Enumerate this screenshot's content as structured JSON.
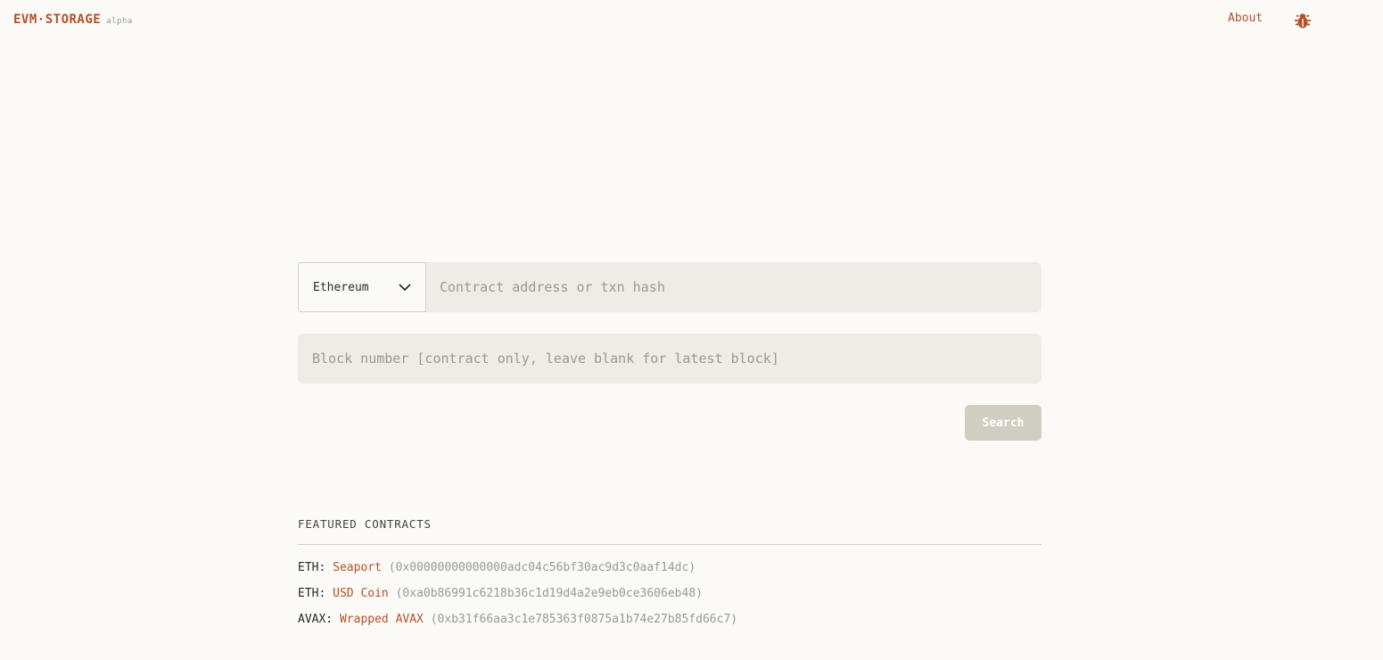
{
  "header": {
    "logo": "EVM·STORAGE",
    "badge": "alpha",
    "about": "About",
    "bug_icon": "bug-icon"
  },
  "colors": {
    "accent": "#b5502a",
    "background": "#fbfaf7",
    "input_bg": "#edece6",
    "button_bg": "#cfcec0"
  },
  "search": {
    "network": "Ethereum",
    "address_placeholder": "Contract address or txn hash",
    "block_placeholder": "Block number [contract only, leave blank for latest block]",
    "button": "Search"
  },
  "featured": {
    "title": "FEATURED CONTRACTS",
    "items": [
      {
        "chain": "ETH:",
        "name": "Seaport",
        "address": "(0x00000000000000adc04c56bf30ac9d3c0aaf14dc)"
      },
      {
        "chain": "ETH:",
        "name": "USD Coin",
        "address": "(0xa0b86991c6218b36c1d19d4a2e9eb0ce3606eb48)"
      },
      {
        "chain": "AVAX:",
        "name": "Wrapped AVAX",
        "address": "(0xb31f66aa3c1e785363f0875a1b74e27b85fd66c7)"
      }
    ]
  }
}
